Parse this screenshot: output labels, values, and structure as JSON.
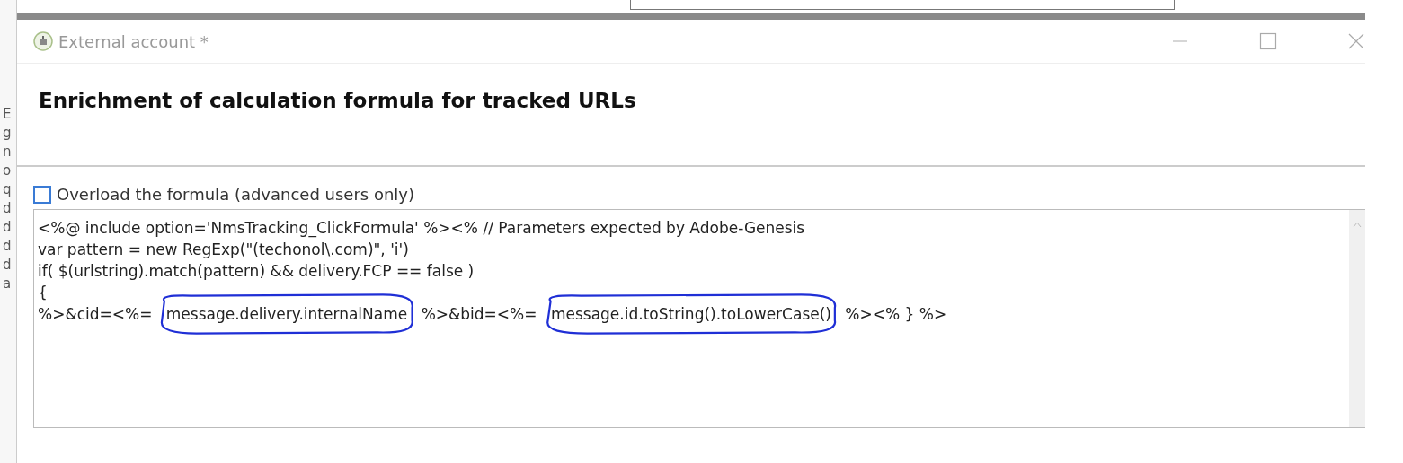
{
  "background_window": {
    "letters": [
      "E",
      "g",
      "n",
      "o",
      "q",
      "d",
      "d",
      "d",
      "d",
      "a"
    ]
  },
  "window": {
    "title": "External account *"
  },
  "heading": "Enrichment of calculation formula for tracked URLs",
  "overload_checkbox": {
    "label": "Overload the formula (advanced users only)",
    "checked": false
  },
  "code_lines": [
    [
      {
        "kind": "plain",
        "text": "<%@ include option='NmsTracking_ClickFormula' %><% // Parameters expected by Adobe-Genesis"
      }
    ],
    [
      {
        "kind": "plain",
        "text": "var pattern = new RegExp(\"(techonol\\.com)\", 'i')"
      }
    ],
    [
      {
        "kind": "plain",
        "text": "if( $(urlstring).match(pattern) && delivery.FCP == false )"
      }
    ],
    [
      {
        "kind": "plain",
        "text": "{"
      }
    ],
    [
      {
        "kind": "plain",
        "text": "%>&cid=<%= "
      },
      {
        "kind": "circled",
        "text": "message.delivery.internalName"
      },
      {
        "kind": "plain",
        "text": " %>&bid=<%= "
      },
      {
        "kind": "circled",
        "text": "message.id.toString().toLowerCase()"
      },
      {
        "kind": "plain",
        "text": " %><% } %>"
      }
    ]
  ]
}
